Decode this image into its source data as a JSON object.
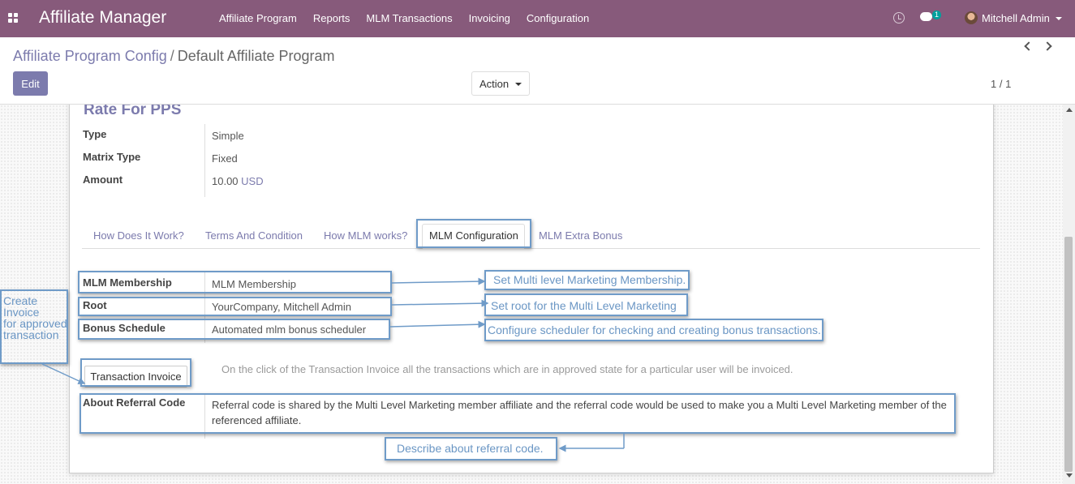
{
  "navbar": {
    "app_title": "Affiliate Manager",
    "menu": [
      "Affiliate Program",
      "Reports",
      "MLM Transactions",
      "Invoicing",
      "Configuration"
    ],
    "chat_badge": "1",
    "user_name": "Mitchell Admin",
    "color": "#875a7b"
  },
  "breadcrumb": {
    "parent": "Affiliate Program Config",
    "separator": "/",
    "current": "Default Affiliate Program"
  },
  "toolbar": {
    "edit_label": "Edit",
    "action_label": "Action",
    "pager": "1 / 1"
  },
  "form": {
    "section_title": "Rate For PPS",
    "type_label": "Type",
    "type_value": "Simple",
    "matrix_label": "Matrix Type",
    "matrix_value": "Fixed",
    "amount_label": "Amount",
    "amount_value": "10.00",
    "amount_currency": "USD",
    "tabs": [
      "How Does It Work?",
      "Terms And Condition",
      "How MLM works?",
      "MLM Configuration",
      "MLM Extra Bonus"
    ],
    "active_tab": "MLM Configuration",
    "membership_label": "MLM Membership",
    "membership_value": "MLM Membership",
    "root_label": "Root",
    "root_value": "YourCompany, Mitchell Admin",
    "bonus_label": "Bonus Schedule",
    "bonus_value": "Automated mlm bonus scheduler",
    "transaction_invoice_button": "Transaction Invoice",
    "transaction_invoice_help": "On the click of the Transaction Invoice all the transactions which are in approved state for a particular user will be invoiced.",
    "referral_label": "About Referral Code",
    "referral_value": "Referral code is shared by the Multi Level Marketing member affiliate and the referral code would be used to make you a Multi Level Marketing member of the referenced affiliate."
  },
  "annotations": {
    "membership_note": "Set Multi level Marketing Membership.",
    "root_note": "Set root for the Multi Level Marketing",
    "bonus_note": "Configure scheduler for checking and creating bonus transactions.",
    "invoice_note_lines": [
      "Create",
      "Invoice",
      "for approved",
      "transaction"
    ],
    "referral_note": "Describe about referral code.",
    "color": "#6f9bc8"
  }
}
